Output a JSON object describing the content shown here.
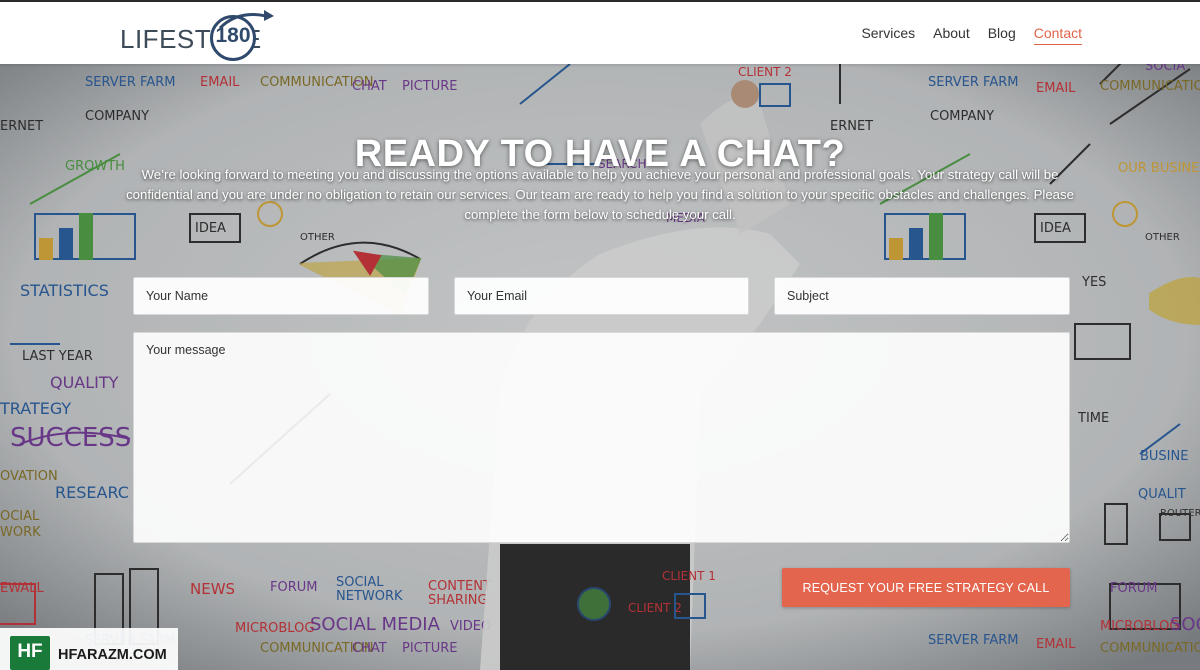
{
  "header": {
    "logo": {
      "text": "LIFESTYLE",
      "number": "180"
    },
    "nav": [
      {
        "label": "Services",
        "active": false
      },
      {
        "label": "About",
        "active": false
      },
      {
        "label": "Blog",
        "active": false
      },
      {
        "label": "Contact",
        "active": true
      }
    ]
  },
  "hero": {
    "title": "READY TO HAVE A CHAT?",
    "description": "We’re looking forward to meeting you and discussing the options available to help you achieve your personal and professional goals. Your strategy call will be confidential and you are under no obligation to retain our services. Our team are ready to help you find a solution to your specific obstacles and challenges. Please complete the form below to schedule your call."
  },
  "form": {
    "name_placeholder": "Your Name",
    "email_placeholder": "Your Email",
    "subject_placeholder": "Subject",
    "message_placeholder": "Your message",
    "submit_label": "REQUEST YOUR FREE STRATEGY CALL"
  },
  "watermark": {
    "badge": "HF",
    "text": "HFARAZM.COM"
  },
  "colors": {
    "accent": "#e3654d",
    "logo_blue": "#2f4a6c",
    "nav_text": "#333333"
  }
}
